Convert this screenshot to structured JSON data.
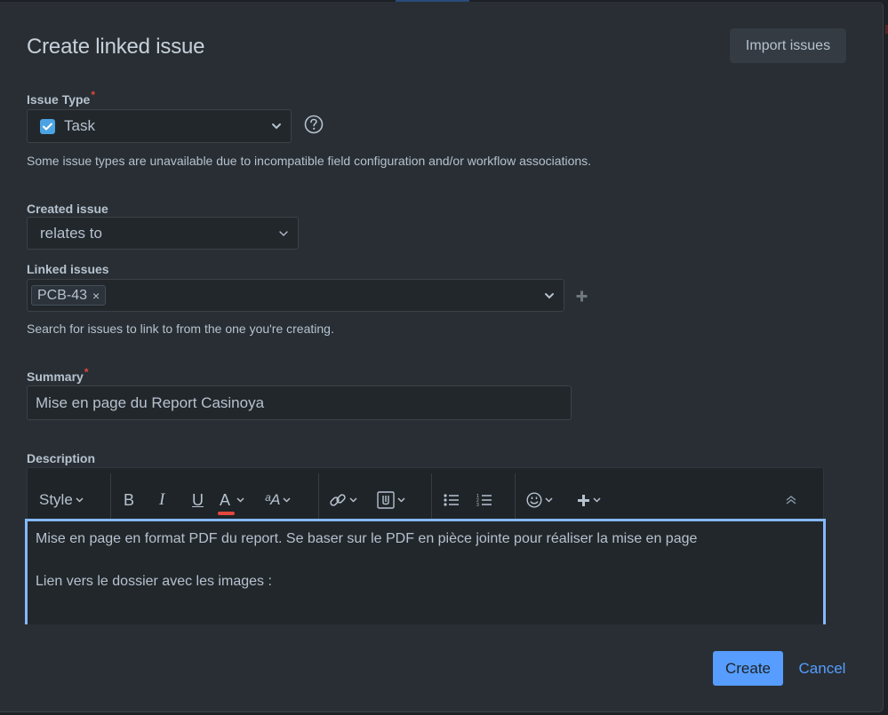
{
  "dialog": {
    "title": "Create linked issue",
    "import_button": "Import issues"
  },
  "issue_type": {
    "label": "Issue Type",
    "required_mark": "*",
    "value": "Task",
    "icon": "task-checkbox-icon",
    "help_icon": "question-circle-icon",
    "hint": "Some issue types are unavailable due to incompatible field configuration and/or workflow associations."
  },
  "created_issue": {
    "label": "Created issue",
    "value": "relates to"
  },
  "linked_issues": {
    "label": "Linked issues",
    "chips": [
      {
        "key": "PCB-43",
        "remove": "×"
      }
    ],
    "hint": "Search for issues to link to from the one you're creating."
  },
  "summary": {
    "label": "Summary",
    "required_mark": "*",
    "value": "Mise en page du Report Casinoya"
  },
  "description": {
    "label": "Description",
    "toolbar": {
      "style": "Style",
      "bold": "B",
      "italic": "I",
      "underline": "U",
      "text_color": "A",
      "text_color_accent": "#e2483d",
      "more_formatting": "ᵃA",
      "icons": [
        "link-icon",
        "attachment-icon",
        "bullet-list-icon",
        "numbered-list-icon",
        "emoji-icon",
        "insert-plus-icon",
        "collapse-toolbar-icon"
      ]
    },
    "lines": [
      "Mise en page en format PDF du report. Se baser sur le PDF en pièce jointe pour réaliser la mise en page",
      "",
      "Lien vers le dossier avec les images :"
    ]
  },
  "footer": {
    "create": "Create",
    "cancel": "Cancel"
  },
  "colors": {
    "primary": "#579dff",
    "focus_border": "#85b8ff",
    "dialog_bg": "#282e33",
    "task_icon": "#4ba3e3"
  }
}
